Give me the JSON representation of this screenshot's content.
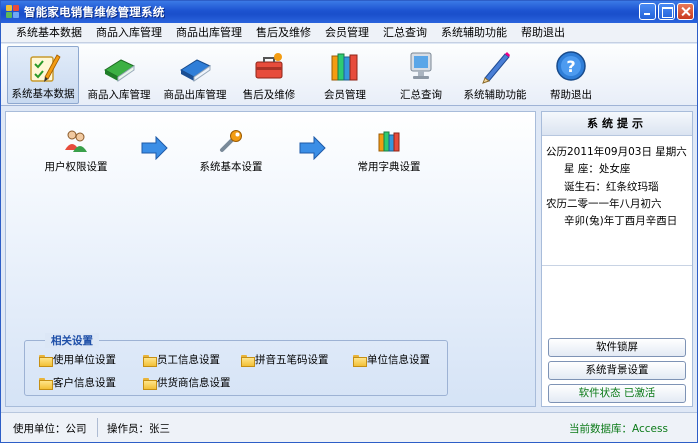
{
  "window": {
    "title": "智能家电销售维修管理系统",
    "icon": "app-logo-icon"
  },
  "menubar": {
    "items": [
      {
        "label": "系统基本数据"
      },
      {
        "label": "商品入库管理"
      },
      {
        "label": "商品出库管理"
      },
      {
        "label": "售后及维修"
      },
      {
        "label": "会员管理"
      },
      {
        "label": "汇总查询"
      },
      {
        "label": "系统辅助功能"
      },
      {
        "label": "帮助退出"
      }
    ]
  },
  "toolbar": {
    "active_index": 0,
    "items": [
      {
        "label": "系统基本数据",
        "icon": "checklist-pencil-icon"
      },
      {
        "label": "商品入库管理",
        "icon": "green-book-icon"
      },
      {
        "label": "商品出库管理",
        "icon": "blue-book-icon"
      },
      {
        "label": "售后及维修",
        "icon": "toolbox-icon"
      },
      {
        "label": "会员管理",
        "icon": "books-icon"
      },
      {
        "label": "汇总查询",
        "icon": "monitor-icon"
      },
      {
        "label": "系统辅助功能",
        "icon": "pencil-icon"
      },
      {
        "label": "帮助退出",
        "icon": "help-icon"
      }
    ]
  },
  "main": {
    "flow": [
      {
        "label": "用户权限设置",
        "icon": "users-icon"
      },
      {
        "label": "系统基本设置",
        "icon": "wrench-icon"
      },
      {
        "label": "常用字典设置",
        "icon": "dictionary-icon"
      }
    ],
    "related": {
      "title": "相关设置",
      "links": [
        {
          "label": "使用单位设置"
        },
        {
          "label": "员工信息设置"
        },
        {
          "label": "拼音五笔码设置"
        },
        {
          "label": "单位信息设置"
        },
        {
          "label": "客户信息设置"
        },
        {
          "label": "供货商信息设置"
        }
      ]
    }
  },
  "panel": {
    "title": "系统提示",
    "calendar": {
      "solar": "公历2011年09月03日   星期六",
      "zodiac": "星  座：处女座",
      "birthstone": "诞生石：红条纹玛瑙",
      "lunar": "农历二零一一年八月初六",
      "ganzhi": "辛卯(兔)年丁酉月辛酉日"
    },
    "buttons": {
      "lock": "软件锁屏",
      "background": "系统背景设置",
      "status": "软件状态  已激活"
    }
  },
  "statusbar": {
    "unit": "使用单位：公司",
    "operator": "操作员：张三",
    "database": "当前数据库：Access"
  },
  "colors": {
    "titlebar": "#1c53d0",
    "accent": "#1e4fa8",
    "status_green": "#0b7a18"
  }
}
